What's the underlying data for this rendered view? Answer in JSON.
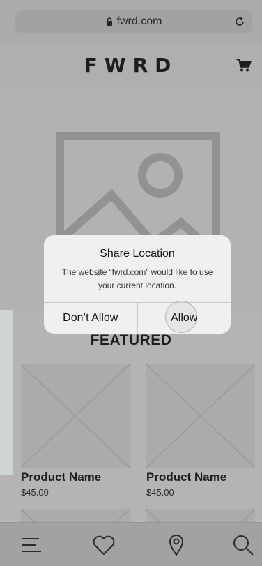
{
  "browser": {
    "url": "fwrd.com",
    "icons": {
      "lock": "lock-icon",
      "reload": "reload-icon"
    }
  },
  "header": {
    "brand": "FWRD",
    "cart_icon": "cart-icon"
  },
  "hero": {
    "image_icon": "image-placeholder-icon"
  },
  "featured": {
    "title": "FEATURED",
    "products": [
      {
        "name": "Product Name",
        "price": "$45.00"
      },
      {
        "name": "Product Name",
        "price": "$45.00"
      }
    ]
  },
  "bottom_nav": {
    "items": [
      {
        "icon": "menu-icon"
      },
      {
        "icon": "heart-icon"
      },
      {
        "icon": "location-pin-icon"
      },
      {
        "icon": "search-icon"
      }
    ]
  },
  "dialog": {
    "title": "Share Location",
    "message": "The website “fwrd.com” would like to use your current location.",
    "deny_label": "Don’t Allow",
    "allow_label": "Allow"
  },
  "colors": {
    "page_bg": "#c9c9c9",
    "dialog_bg": "#f2f2f2",
    "text": "#111111"
  }
}
